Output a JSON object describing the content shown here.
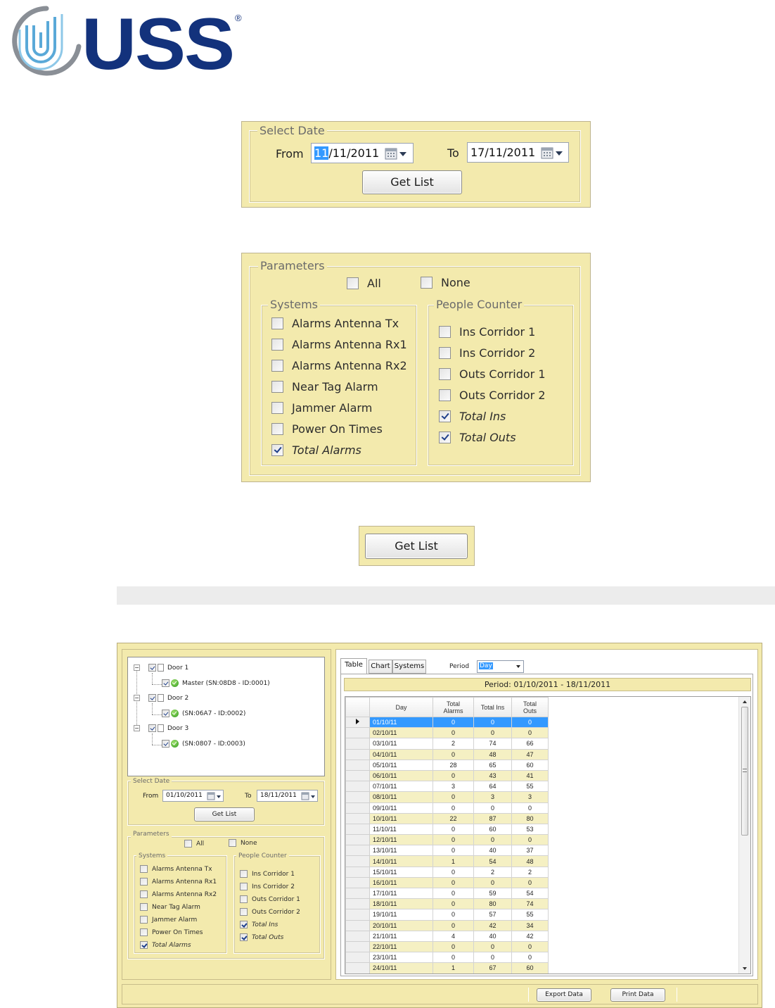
{
  "logo": {
    "text": "USS",
    "registered": "®"
  },
  "select_date_dialog": {
    "legend": "Select Date",
    "from_label": "From",
    "from_value_selected": "11",
    "from_value_rest": "/11/2011",
    "to_label": "To",
    "to_value": "17/11/2011",
    "button": "Get List"
  },
  "parameters_dialog": {
    "legend": "Parameters",
    "all": "All",
    "none": "None",
    "systems_legend": "Systems",
    "systems": [
      {
        "label": "Alarms Antenna Tx",
        "checked": false
      },
      {
        "label": "Alarms Antenna Rx1",
        "checked": false
      },
      {
        "label": "Alarms Antenna Rx2",
        "checked": false
      },
      {
        "label": "Near Tag Alarm",
        "checked": false
      },
      {
        "label": "Jammer Alarm",
        "checked": false
      },
      {
        "label": "Power On Times",
        "checked": false
      },
      {
        "label": "Total Alarms",
        "checked": true
      }
    ],
    "people_legend": "People Counter",
    "people": [
      {
        "label": "Ins Corridor 1",
        "checked": false
      },
      {
        "label": "Ins Corridor 2",
        "checked": false
      },
      {
        "label": "Outs Corridor 1",
        "checked": false
      },
      {
        "label": "Outs Corridor 2",
        "checked": false
      },
      {
        "label": "Total Ins",
        "checked": true
      },
      {
        "label": "Total Outs",
        "checked": true
      }
    ]
  },
  "get_list_dialog": {
    "button": "Get List"
  },
  "app": {
    "tree": [
      {
        "label": "Door 1",
        "child": "Master (SN:08D8 - ID:0001)"
      },
      {
        "label": "Door 2",
        "child": "(SN:06A7 - ID:0002)"
      },
      {
        "label": "Door 3",
        "child": "(SN:0807 - ID:0003)"
      }
    ],
    "select_date": {
      "legend": "Select Date",
      "from_label": "From",
      "from_value": "01/10/2011",
      "to_label": "To",
      "to_value": "18/11/2011",
      "button": "Get List"
    },
    "parameters": {
      "legend": "Parameters",
      "all": "All",
      "none": "None",
      "systems_legend": "Systems",
      "people_legend": "People Counter"
    },
    "tabs": [
      "Table",
      "Chart",
      "Systems"
    ],
    "period_label": "Period",
    "period_value": "Day",
    "period_banner": "Period: 01/10/2011 - 18/11/2011",
    "table": {
      "headers": [
        "Day",
        "Total\nAlarms",
        "Total Ins",
        "Total\nOuts"
      ],
      "rows": [
        [
          "01/10/11",
          "0",
          "0",
          "0"
        ],
        [
          "02/10/11",
          "0",
          "0",
          "0"
        ],
        [
          "03/10/11",
          "2",
          "74",
          "66"
        ],
        [
          "04/10/11",
          "0",
          "48",
          "47"
        ],
        [
          "05/10/11",
          "28",
          "65",
          "60"
        ],
        [
          "06/10/11",
          "0",
          "43",
          "41"
        ],
        [
          "07/10/11",
          "3",
          "64",
          "55"
        ],
        [
          "08/10/11",
          "0",
          "3",
          "3"
        ],
        [
          "09/10/11",
          "0",
          "0",
          "0"
        ],
        [
          "10/10/11",
          "22",
          "87",
          "80"
        ],
        [
          "11/10/11",
          "0",
          "60",
          "53"
        ],
        [
          "12/10/11",
          "0",
          "0",
          "0"
        ],
        [
          "13/10/11",
          "0",
          "40",
          "37"
        ],
        [
          "14/10/11",
          "1",
          "54",
          "48"
        ],
        [
          "15/10/11",
          "0",
          "2",
          "2"
        ],
        [
          "16/10/11",
          "0",
          "0",
          "0"
        ],
        [
          "17/10/11",
          "0",
          "59",
          "54"
        ],
        [
          "18/10/11",
          "0",
          "80",
          "74"
        ],
        [
          "19/10/11",
          "0",
          "57",
          "55"
        ],
        [
          "20/10/11",
          "0",
          "42",
          "34"
        ],
        [
          "21/10/11",
          "4",
          "40",
          "42"
        ],
        [
          "22/10/11",
          "0",
          "0",
          "0"
        ],
        [
          "23/10/11",
          "0",
          "0",
          "0"
        ],
        [
          "24/10/11",
          "1",
          "67",
          "60"
        ]
      ]
    },
    "export_button": "Export Data",
    "print_button": "Print Data"
  },
  "colors": {
    "panel": "#f3eaad",
    "logo_blue": "#13327c",
    "selection": "#3399ff"
  }
}
